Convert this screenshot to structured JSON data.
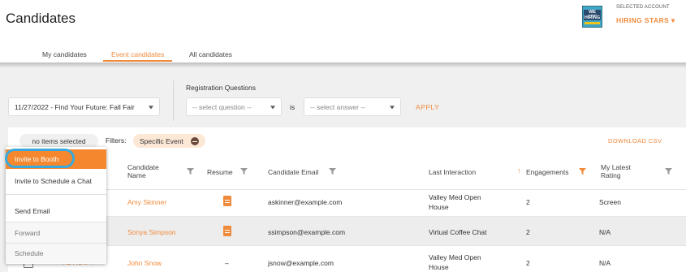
{
  "header": {
    "title": "Candidates",
    "logo_lines": [
      "WE ARE",
      "HIRING"
    ],
    "account_label": "SELECTED ACCOUNT",
    "account_name": "HIRING STARS ▾"
  },
  "tabs": [
    {
      "label": "My candidates",
      "active": false
    },
    {
      "label": "Event candidates",
      "active": true
    },
    {
      "label": "All candidates",
      "active": false
    }
  ],
  "filters": {
    "event_select_value": "11/27/2022 - Find Your Future: Fall Fair",
    "registration_label": "Registration Questions",
    "question_placeholder": "-- select question --",
    "is_label": "is",
    "answer_placeholder": "-- select answer --",
    "apply_label": "APPLY"
  },
  "toolbar": {
    "selection_chip": "no items selected",
    "filters_label": "Filters:",
    "filter_tag": "Specific Event",
    "download_csv": "DOWNLOAD CSV"
  },
  "columns": {
    "name": [
      "Candidate",
      "Name"
    ],
    "resume": "Resume",
    "email": "Candidate Email",
    "last_interaction": "Last Interaction",
    "engagements": "Engagements",
    "rating": [
      "My Latest",
      "Rating"
    ]
  },
  "rows": [
    {
      "name": "Amy Skinner",
      "resume": "doc",
      "email": "askinner@example.com",
      "last_interaction": [
        "Valley Med Open",
        "House"
      ],
      "engagements": "2",
      "rating": "Screen"
    },
    {
      "name": "Sonya Simpson",
      "resume": "doc",
      "email": "ssimpson@example.com",
      "last_interaction": [
        "Virtual Coffee Chat"
      ],
      "engagements": "2",
      "rating": "N/A"
    },
    {
      "name": "John Snow",
      "resume": "–",
      "email": "jsnow@example.com",
      "last_interaction": [
        "Valley Med Open",
        "House"
      ],
      "engagements": "2",
      "rating": "N/A"
    }
  ],
  "row3_action_partial": "ACTION ▾",
  "action_menu": {
    "items": [
      "Invite to Booth",
      "Invite to Schedule a Chat",
      "Send Email",
      "Forward",
      "Schedule"
    ],
    "highlighted": "Invite to Booth"
  },
  "colors": {
    "accent": "#f08a3c",
    "highlight": "#f5882e",
    "focus_ring": "#37a9df"
  }
}
